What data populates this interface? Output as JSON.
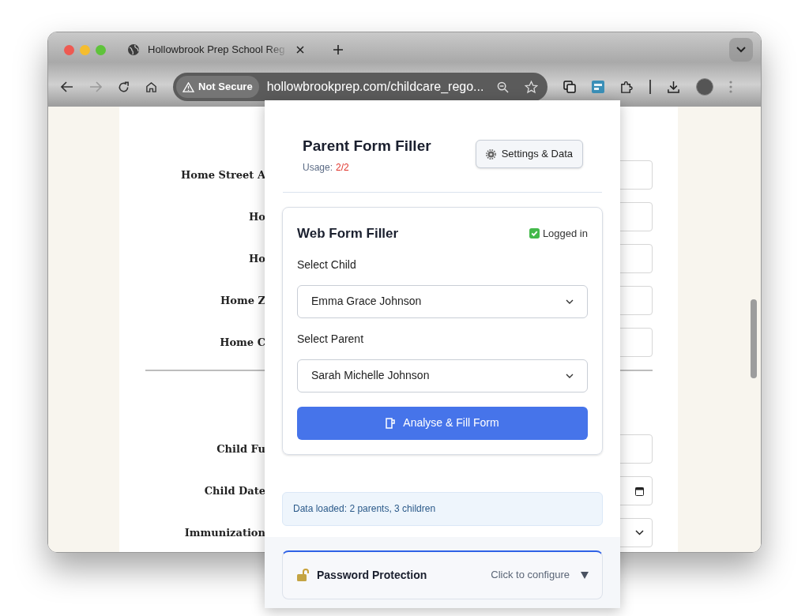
{
  "browser": {
    "tab": {
      "title": "Hollowbrook Prep School Reg"
    },
    "toolbar": {
      "forward_disabled": true
    },
    "address_bar": {
      "security": "Not Secure",
      "url": "hollowbrookprep.com/childcare_rego..."
    }
  },
  "page": {
    "sections": [
      {
        "fields": [
          {
            "label": "Home Street A",
            "kind": "text"
          },
          {
            "label": "Ho",
            "kind": "text"
          },
          {
            "label": "Ho",
            "kind": "text"
          },
          {
            "label": "Home Z",
            "kind": "text"
          },
          {
            "label": "Home C",
            "kind": "text"
          }
        ]
      },
      {
        "fields": [
          {
            "label": "Child Fu",
            "kind": "text"
          },
          {
            "label": "Child Date",
            "kind": "date"
          },
          {
            "label": "Immunization",
            "kind": "select"
          }
        ]
      }
    ]
  },
  "popup": {
    "title": "Parent Form Filler",
    "usage_label": "Usage:",
    "usage_value": "2/2",
    "settings_button": "Settings & Data",
    "card": {
      "title": "Web Form Filler",
      "logged_in": true,
      "login_status": "Logged in",
      "selects": [
        {
          "label": "Select Child",
          "value": "Emma Grace Johnson"
        },
        {
          "label": "Select Parent",
          "value": "Sarah Michelle Johnson"
        }
      ],
      "action_button": "Analyse & Fill Form"
    },
    "status_message": "Data loaded: 2 parents, 3 children",
    "password_panel": {
      "title": "Password Protection",
      "hint": "Click to configure",
      "expanded": false
    }
  }
}
